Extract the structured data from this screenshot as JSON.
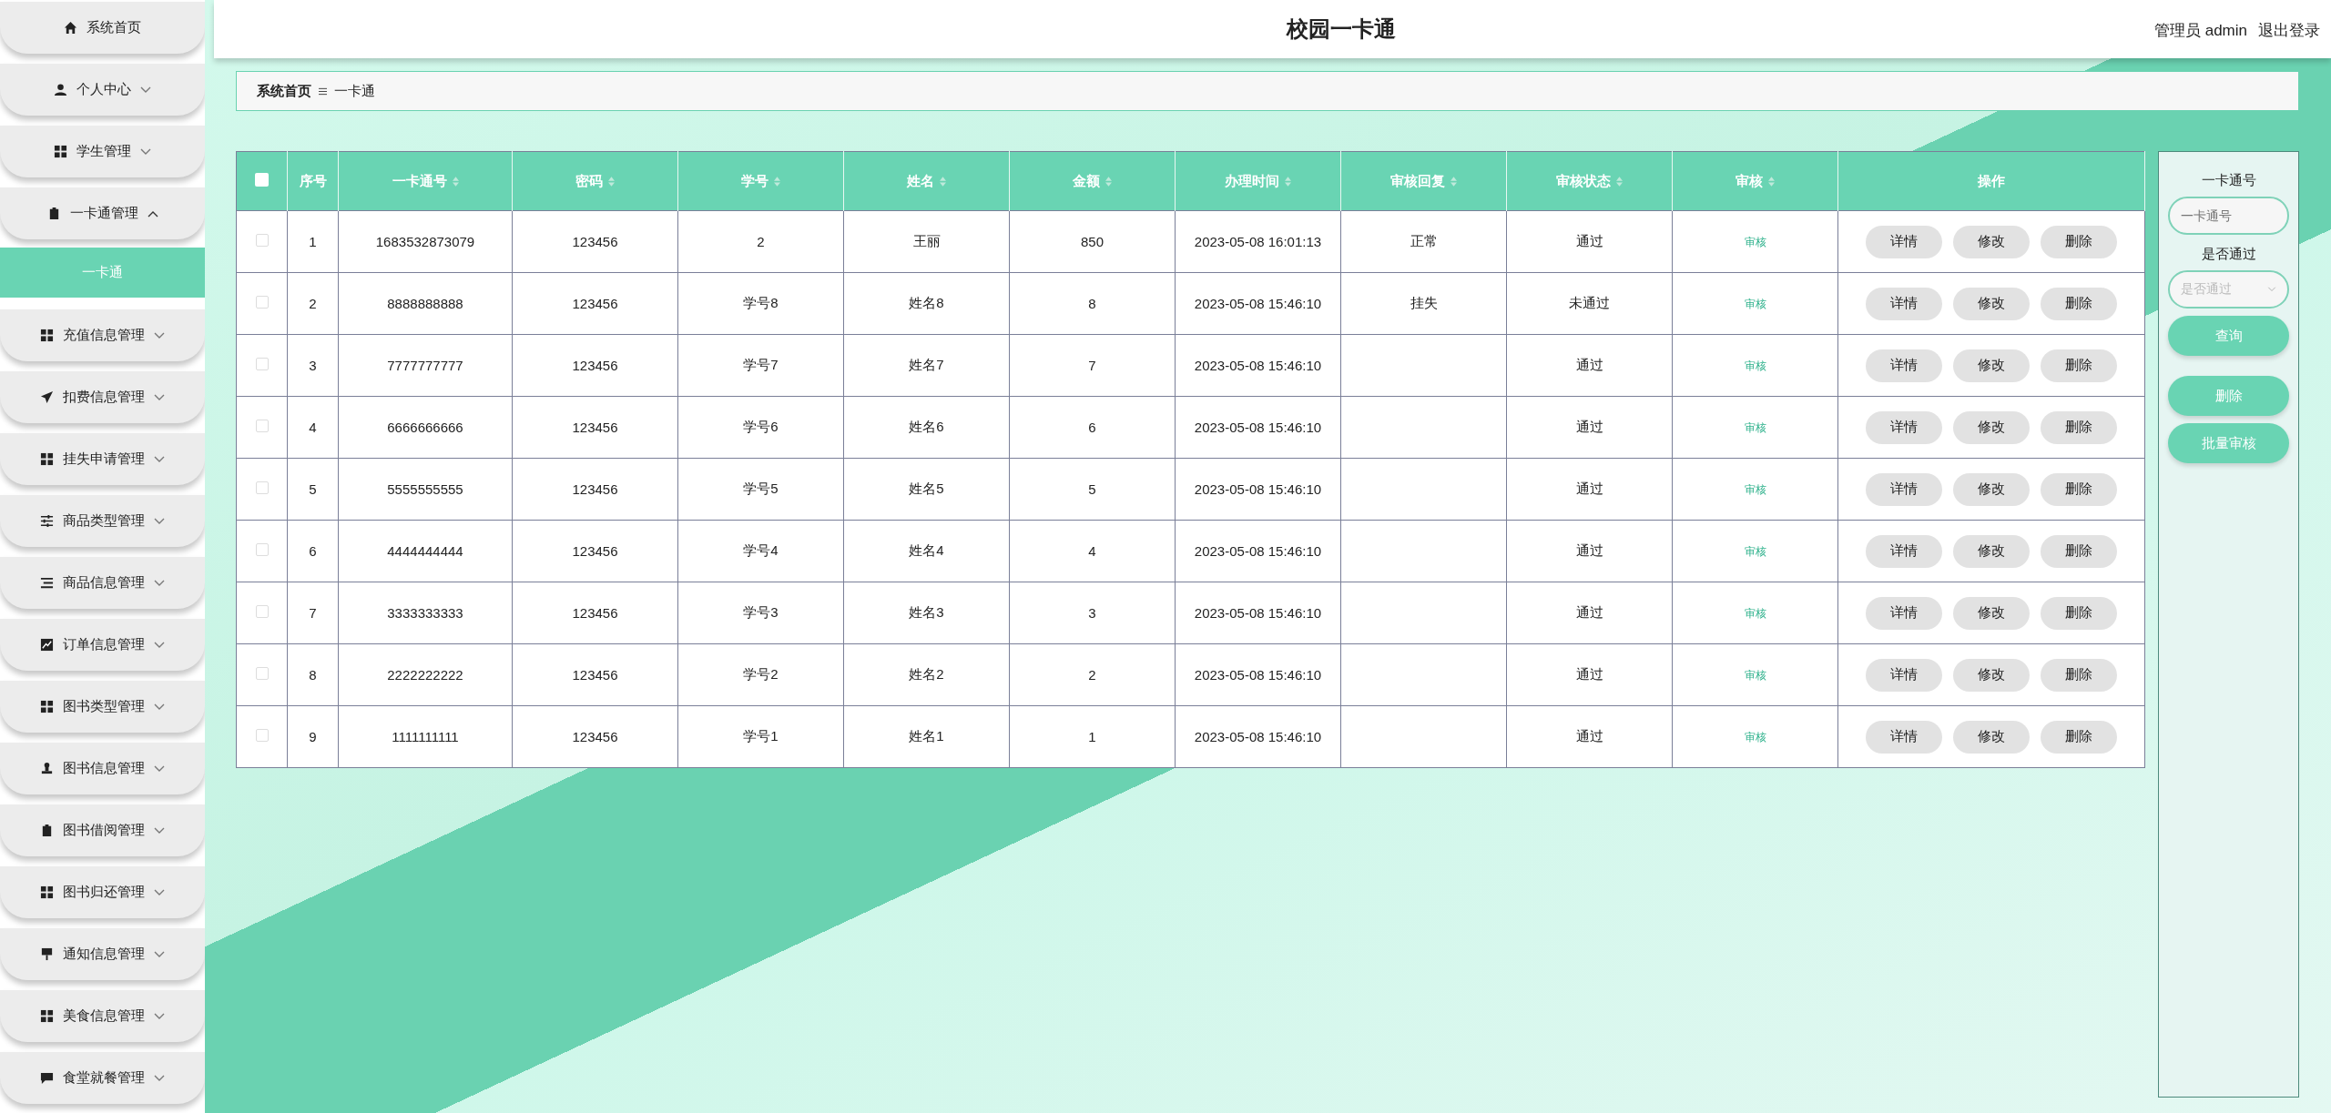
{
  "header": {
    "title": "校园一卡通",
    "user": "管理员 admin",
    "logout": "退出登录"
  },
  "sidebar": {
    "items": [
      {
        "label": "系统首页",
        "kind": "link"
      },
      {
        "label": "个人中心",
        "kind": "menu",
        "expanded": false
      },
      {
        "label": "学生管理",
        "kind": "menu",
        "expanded": false
      },
      {
        "label": "一卡通管理",
        "kind": "menu",
        "expanded": true,
        "children": [
          {
            "label": "一卡通",
            "selected": true
          }
        ]
      },
      {
        "label": "充值信息管理",
        "kind": "menu",
        "expanded": false
      },
      {
        "label": "扣费信息管理",
        "kind": "menu",
        "expanded": false
      },
      {
        "label": "挂失申请管理",
        "kind": "menu",
        "expanded": false
      },
      {
        "label": "商品类型管理",
        "kind": "menu",
        "expanded": false
      },
      {
        "label": "商品信息管理",
        "kind": "menu",
        "expanded": false
      },
      {
        "label": "订单信息管理",
        "kind": "menu",
        "expanded": false
      },
      {
        "label": "图书类型管理",
        "kind": "menu",
        "expanded": false
      },
      {
        "label": "图书信息管理",
        "kind": "menu",
        "expanded": false
      },
      {
        "label": "图书借阅管理",
        "kind": "menu",
        "expanded": false
      },
      {
        "label": "图书归还管理",
        "kind": "menu",
        "expanded": false
      },
      {
        "label": "通知信息管理",
        "kind": "menu",
        "expanded": false
      },
      {
        "label": "美食信息管理",
        "kind": "menu",
        "expanded": false
      },
      {
        "label": "食堂就餐管理",
        "kind": "menu",
        "expanded": false
      }
    ]
  },
  "breadcrumb": [
    "系统首页",
    "一卡通"
  ],
  "table": {
    "select_all_checked": false,
    "columns": [
      {
        "label": "序号",
        "sortable": false
      },
      {
        "label": "一卡通号",
        "sortable": true
      },
      {
        "label": "密码",
        "sortable": true
      },
      {
        "label": "学号",
        "sortable": true
      },
      {
        "label": "姓名",
        "sortable": true
      },
      {
        "label": "金额",
        "sortable": true
      },
      {
        "label": "办理时间",
        "sortable": true
      },
      {
        "label": "审核回复",
        "sortable": true
      },
      {
        "label": "审核状态",
        "sortable": true
      },
      {
        "label": "审核",
        "sortable": true
      },
      {
        "label": "操作",
        "sortable": false
      }
    ],
    "rows": [
      {
        "checked": false,
        "cells": [
          "1",
          "1683532873079",
          "123456",
          "2",
          "王丽",
          "850",
          "2023-05-08 16:01:13",
          "正常",
          "通过"
        ],
        "review": "审核",
        "actions": [
          "详情",
          "修改",
          "删除"
        ]
      },
      {
        "checked": false,
        "cells": [
          "2",
          "8888888888",
          "123456",
          "学号8",
          "姓名8",
          "8",
          "2023-05-08 15:46:10",
          "挂失",
          "未通过"
        ],
        "review": "审核",
        "actions": [
          "详情",
          "修改",
          "删除"
        ]
      },
      {
        "checked": false,
        "cells": [
          "3",
          "7777777777",
          "123456",
          "学号7",
          "姓名7",
          "7",
          "2023-05-08 15:46:10",
          "",
          "通过"
        ],
        "review": "审核",
        "actions": [
          "详情",
          "修改",
          "删除"
        ]
      },
      {
        "checked": false,
        "cells": [
          "4",
          "6666666666",
          "123456",
          "学号6",
          "姓名6",
          "6",
          "2023-05-08 15:46:10",
          "",
          "通过"
        ],
        "review": "审核",
        "actions": [
          "详情",
          "修改",
          "删除"
        ]
      },
      {
        "checked": false,
        "cells": [
          "5",
          "5555555555",
          "123456",
          "学号5",
          "姓名5",
          "5",
          "2023-05-08 15:46:10",
          "",
          "通过"
        ],
        "review": "审核",
        "actions": [
          "详情",
          "修改",
          "删除"
        ]
      },
      {
        "checked": false,
        "cells": [
          "6",
          "4444444444",
          "123456",
          "学号4",
          "姓名4",
          "4",
          "2023-05-08 15:46:10",
          "",
          "通过"
        ],
        "review": "审核",
        "actions": [
          "详情",
          "修改",
          "删除"
        ]
      },
      {
        "checked": false,
        "cells": [
          "7",
          "3333333333",
          "123456",
          "学号3",
          "姓名3",
          "3",
          "2023-05-08 15:46:10",
          "",
          "通过"
        ],
        "review": "审核",
        "actions": [
          "详情",
          "修改",
          "删除"
        ]
      },
      {
        "checked": false,
        "cells": [
          "8",
          "2222222222",
          "123456",
          "学号2",
          "姓名2",
          "2",
          "2023-05-08 15:46:10",
          "",
          "通过"
        ],
        "review": "审核",
        "actions": [
          "详情",
          "修改",
          "删除"
        ]
      },
      {
        "checked": false,
        "cells": [
          "9",
          "1111111111",
          "123456",
          "学号1",
          "姓名1",
          "1",
          "2023-05-08 15:46:10",
          "",
          "通过"
        ],
        "review": "审核",
        "actions": [
          "详情",
          "修改",
          "删除"
        ]
      }
    ]
  },
  "search_panel": {
    "card_label": "一卡通号",
    "card_placeholder": "一卡通号",
    "pass_label": "是否通过",
    "pass_placeholder": "是否通过",
    "buttons": [
      "查询",
      "删除",
      "批量审核"
    ]
  }
}
